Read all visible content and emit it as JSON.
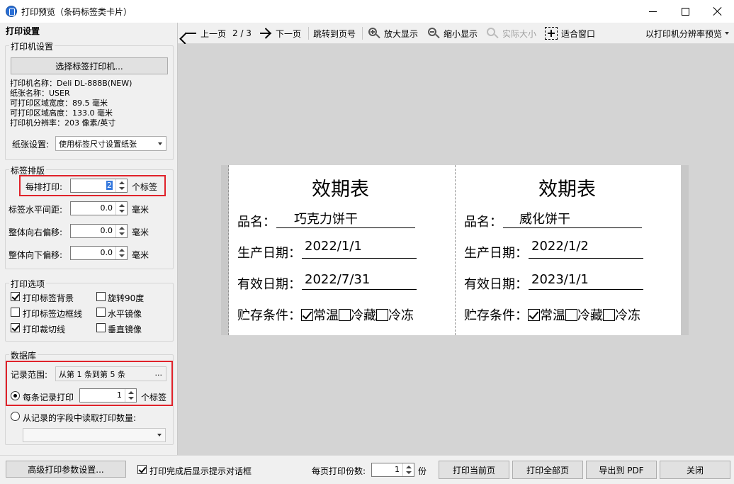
{
  "window": {
    "title": "打印预览（条码标签类卡片）"
  },
  "left_panel": {
    "title": "打印设置",
    "printer_group": {
      "label": "打印机设置",
      "select_button": "选择标签打印机...",
      "info": [
        "打印机名称：Deli DL-888B(NEW)",
        "纸张名称：USER",
        "可打印区域宽度：89.5 毫米",
        "可打印区域高度：133.0 毫米",
        "打印机分辨率：203 像素/英寸"
      ],
      "paper_label": "纸张设置:",
      "paper_value": "使用标签尺寸设置纸张"
    },
    "layout_group": {
      "label": "标签排版",
      "rows": [
        {
          "label": "每排打印:",
          "value": "2",
          "unit": "个标签"
        },
        {
          "label": "标签水平间距:",
          "value": "0.0",
          "unit": "毫米"
        },
        {
          "label": "整体向右偏移:",
          "value": "0.0",
          "unit": "毫米"
        },
        {
          "label": "整体向下偏移:",
          "value": "0.0",
          "unit": "毫米"
        }
      ]
    },
    "options_group": {
      "label": "打印选项",
      "checks": [
        {
          "label": "打印标签背景",
          "checked": true
        },
        {
          "label": "旋转90度",
          "checked": false
        },
        {
          "label": "打印标签边框线",
          "checked": false
        },
        {
          "label": "水平镜像",
          "checked": false
        },
        {
          "label": "打印裁切线",
          "checked": true
        },
        {
          "label": "垂直镜像",
          "checked": false
        }
      ]
    },
    "db_group": {
      "label": "数据库",
      "range_label": "记录范围:",
      "range_value": "从第 1 条到第 5 条",
      "range_btn": "...",
      "per_record_label": "每条记录打印",
      "per_record_value": "1",
      "per_record_unit": "个标签",
      "from_field_label": "从记录的字段中读取打印数量:"
    }
  },
  "toolbar": {
    "prev": "上一页",
    "page": "2 / 3",
    "next": "下一页",
    "goto": "跳转到页号",
    "zoom_in": "放大显示",
    "zoom_out": "缩小显示",
    "actual": "实际大小",
    "fit": "适合窗口",
    "mode": "以打印机分辨率预览"
  },
  "cards": [
    {
      "title": "效期表",
      "name_label": "品名：",
      "name": "巧克力饼干",
      "prod_label": "生产日期：",
      "prod": "2022/1/1",
      "exp_label": "有效日期：",
      "exp": "2022/7/31",
      "store_label": "贮存条件：",
      "store_opts": [
        "常温",
        "冷藏",
        "冷冻"
      ]
    },
    {
      "title": "效期表",
      "name_label": "品名：",
      "name": "威化饼干",
      "prod_label": "生产日期：",
      "prod": "2022/1/2",
      "exp_label": "有效日期：",
      "exp": "2023/1/1",
      "store_label": "贮存条件：",
      "store_opts": [
        "常温",
        "冷藏",
        "冷冻"
      ]
    }
  ],
  "bottom": {
    "advanced": "高级打印参数设置...",
    "show_dialog": "打印完成后显示提示对话框",
    "copies_label": "每页打印份数:",
    "copies_value": "1",
    "copies_unit": "份",
    "print_current": "打印当前页",
    "print_all": "打印全部页",
    "export_pdf": "导出到 PDF",
    "close": "关闭"
  }
}
